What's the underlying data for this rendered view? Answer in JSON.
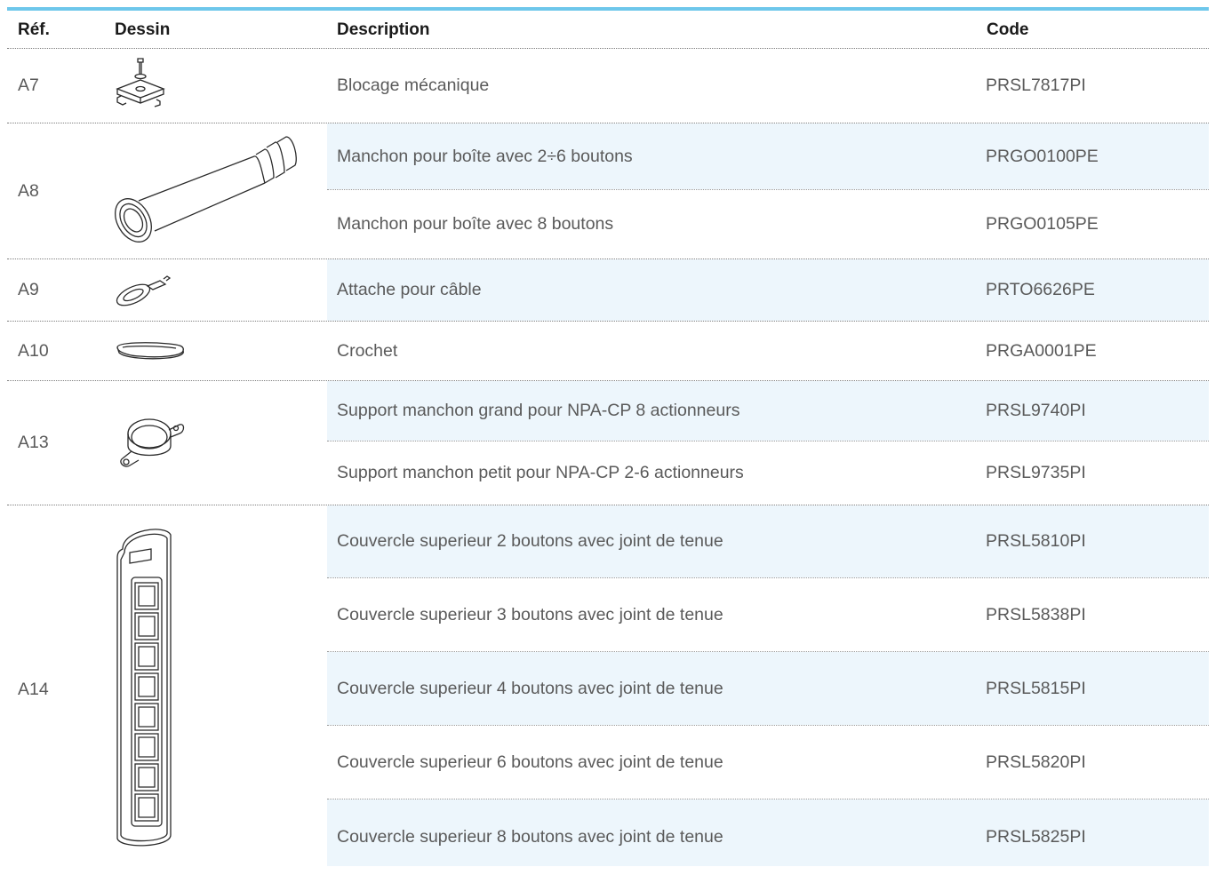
{
  "headers": {
    "ref": "Réf.",
    "drawing": "Dessin",
    "description": "Description",
    "code": "Code"
  },
  "accent_color": "#6ec7eb",
  "row_tint": "#edf6fc",
  "groups": [
    {
      "ref": "A7",
      "drawing_icon": "mechanical-lock-drawing",
      "items": [
        {
          "description": "Blocage mécanique",
          "code": "PRSL7817PI"
        }
      ]
    },
    {
      "ref": "A8",
      "drawing_icon": "sleeve-drawing",
      "items": [
        {
          "description": "Manchon pour boîte avec 2÷6 boutons",
          "code": "PRGO0100PE"
        },
        {
          "description": "Manchon pour boîte avec 8 boutons",
          "code": "PRGO0105PE"
        }
      ]
    },
    {
      "ref": "A9",
      "drawing_icon": "cable-clip-drawing",
      "items": [
        {
          "description": "Attache pour câble",
          "code": "PRTO6626PE"
        }
      ]
    },
    {
      "ref": "A10",
      "drawing_icon": "hook-drawing",
      "items": [
        {
          "description": "Crochet",
          "code": "PRGA0001PE"
        }
      ]
    },
    {
      "ref": "A13",
      "drawing_icon": "sleeve-support-drawing",
      "items": [
        {
          "description": "Support manchon grand pour NPA-CP 8 actionneurs",
          "code": "PRSL9740PI"
        },
        {
          "description": "Support manchon petit pour NPA-CP 2-6 actionneurs",
          "code": "PRSL9735PI"
        }
      ]
    },
    {
      "ref": "A14",
      "drawing_icon": "top-cover-drawing",
      "items": [
        {
          "description": "Couvercle superieur 2 boutons avec joint de tenue",
          "code": "PRSL5810PI"
        },
        {
          "description": "Couvercle superieur 3 boutons avec joint de tenue",
          "code": "PRSL5838PI"
        },
        {
          "description": "Couvercle superieur 4 boutons avec joint de tenue",
          "code": "PRSL5815PI"
        },
        {
          "description": "Couvercle superieur 6 boutons avec joint de tenue",
          "code": "PRSL5820PI"
        },
        {
          "description": "Couvercle superieur 8 boutons avec joint de tenue",
          "code": "PRSL5825PI"
        }
      ]
    }
  ]
}
